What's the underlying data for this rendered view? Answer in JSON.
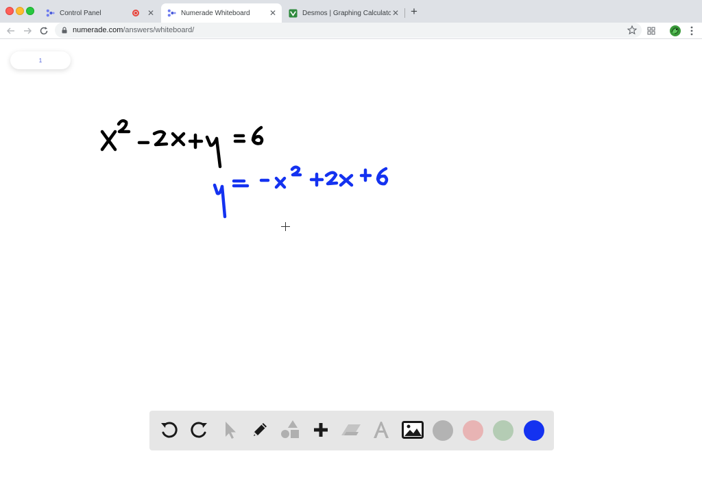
{
  "browser": {
    "tabs": [
      {
        "title": "Control Panel",
        "recording": true
      },
      {
        "title": "Numerade Whiteboard",
        "active": true
      },
      {
        "title": "Desmos | Graphing Calculator"
      }
    ],
    "url_host": "numerade.com",
    "url_path": "/answers/whiteboard/"
  },
  "whiteboard": {
    "page_number": "1",
    "icons": {
      "undo": "undo-icon",
      "redo": "redo-icon",
      "select": "cursor-arrow-icon",
      "pen": "pencil-icon",
      "shapes": "shapes-icon",
      "add": "plus-icon",
      "eraser": "eraser-icon",
      "text": "text-icon",
      "image": "image-icon"
    },
    "colors": {
      "ink_black": "#000000",
      "ink_blue": "#1432f0",
      "swatch_gray": "#b3b3b3",
      "swatch_pink": "#e8b4b4",
      "swatch_green": "#b4ccb4",
      "swatch_blue": "#1432f0",
      "palette_bg": "#e6e6e6"
    }
  }
}
